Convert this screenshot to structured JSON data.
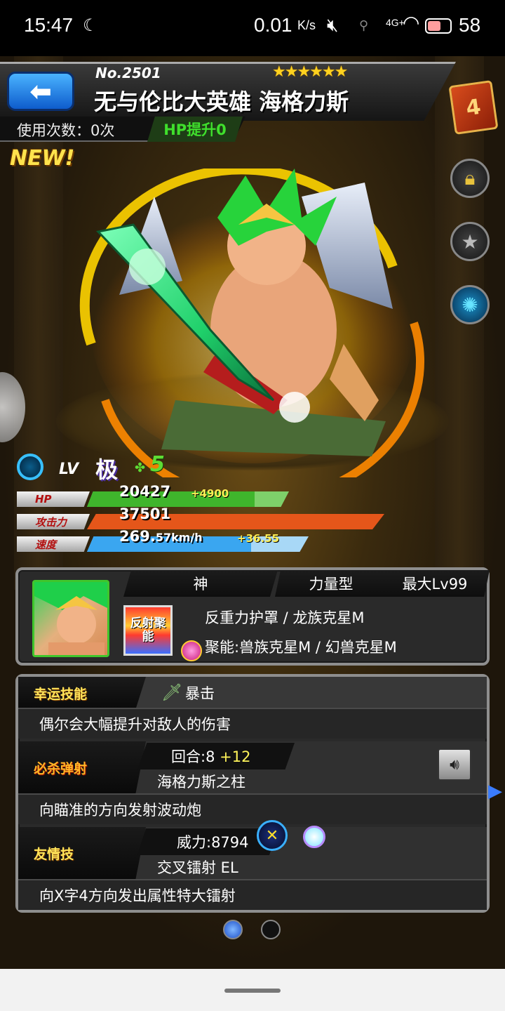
{
  "status_bar": {
    "time": "15:47",
    "moon_icon": "moon-icon",
    "net_speed": "0.01",
    "net_speed_unit": "K/s",
    "network_type": "4G+",
    "battery": "58"
  },
  "header": {
    "monster_no": "No.2501",
    "stars": "★★★★★★",
    "name": "无与伦比大英雄 海格力斯",
    "usage_label": "使用次数：0次",
    "hp_boost": "HP提升0",
    "new_badge": "NEW!",
    "book_icon_text": "4"
  },
  "level": {
    "lv_label": "LV",
    "lv_value": "极",
    "luck_value": "5"
  },
  "stats": {
    "hp": {
      "label": "HP",
      "value": "20427",
      "bonus": "+4900",
      "fill": 0.83
    },
    "attack": {
      "label": "攻击力",
      "value": "37501",
      "bonus": "",
      "fill": 1.0
    },
    "speed": {
      "label": "速度",
      "value": "269.",
      "value_small": "57km/h",
      "bonus": "+36.55",
      "fill": 0.74
    }
  },
  "profile": {
    "tags": [
      "神",
      "力量型",
      "最大Lv99"
    ],
    "ability_icon_text": "反射聚能",
    "ability_line1": "反重力护罩 / 龙族克星M",
    "ability_line2": "聚能:兽族克星M / 幻兽克星M"
  },
  "skills": {
    "luck_skill": {
      "tag": "幸运技能",
      "name": "暴击",
      "desc": "偶尔会大幅提升对敌人的伤害"
    },
    "strike_shot": {
      "tag": "必杀弹射",
      "turns": "回合:8",
      "turns_bonus": "+12",
      "name": "海格力斯之柱",
      "desc": "向瞄准的方向发射波动炮"
    },
    "friendship": {
      "tag": "友情技",
      "power": "威力:8794",
      "name": "交叉镭射 EL",
      "desc": "向X字4方向发出属性特大镭射"
    }
  },
  "colors": {
    "hp_bar": "#3fb52c",
    "attack_bar": "#e5561a",
    "speed_bar": "#3aa6f0",
    "stars": "#ffd21f",
    "element_wood": "#3fe02c"
  }
}
